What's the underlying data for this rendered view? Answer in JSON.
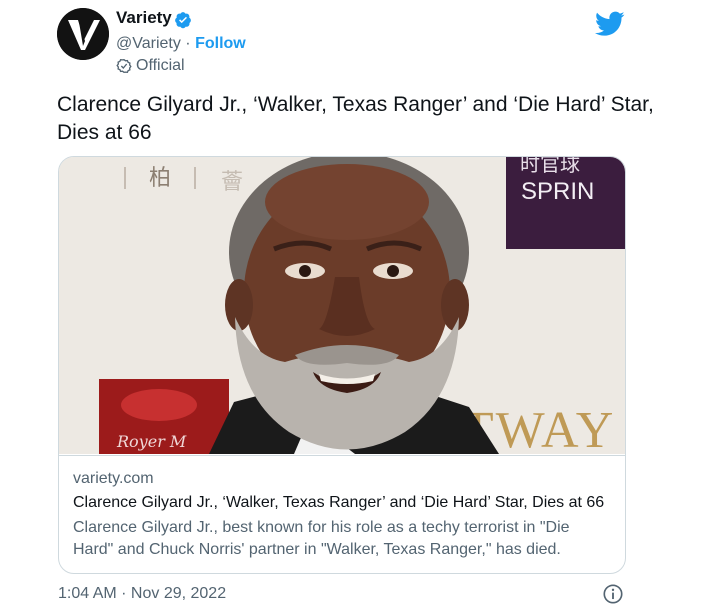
{
  "author": {
    "name": "Variety",
    "handle": "@Variety",
    "separator": " · ",
    "follow_label": "Follow",
    "official_label": "Official",
    "avatar_letter": "V"
  },
  "tweet": {
    "text": "Clarence Gilyard Jr., ‘Walker, Texas Ranger’ and ‘Die Hard’ Star, Dies at 66",
    "timestamp": "1:04 AM · Nov 29, 2022"
  },
  "card": {
    "domain": "variety.com",
    "title": "Clarence Gilyard Jr., ‘Walker, Texas Ranger’ and ‘Die Hard’ Star, Dies at 66",
    "description": "Clarence Gilyard Jr., best known for his role as a techy terrorist in \"Die Hard\" and Chuck Norris' partner in \"Walker, Texas Ranger,\" has died.",
    "image": {
      "backdrop_chars_left": "柏",
      "backdrop_chars_left2": "薈",
      "backdrop_sign_top": "时官球",
      "backdrop_sign_text": "SPRIN",
      "backdrop_bottom_text": "STWAY",
      "backdrop_script_text": "Royer M"
    }
  },
  "icons": {
    "verified": "verified-badge-icon",
    "official": "official-badge-icon",
    "brand": "twitter-bird-icon",
    "info": "info-icon"
  },
  "colors": {
    "accent": "#1d9bf0",
    "text_primary": "#0f1419",
    "text_secondary": "#536471",
    "border": "#cfd9de"
  }
}
